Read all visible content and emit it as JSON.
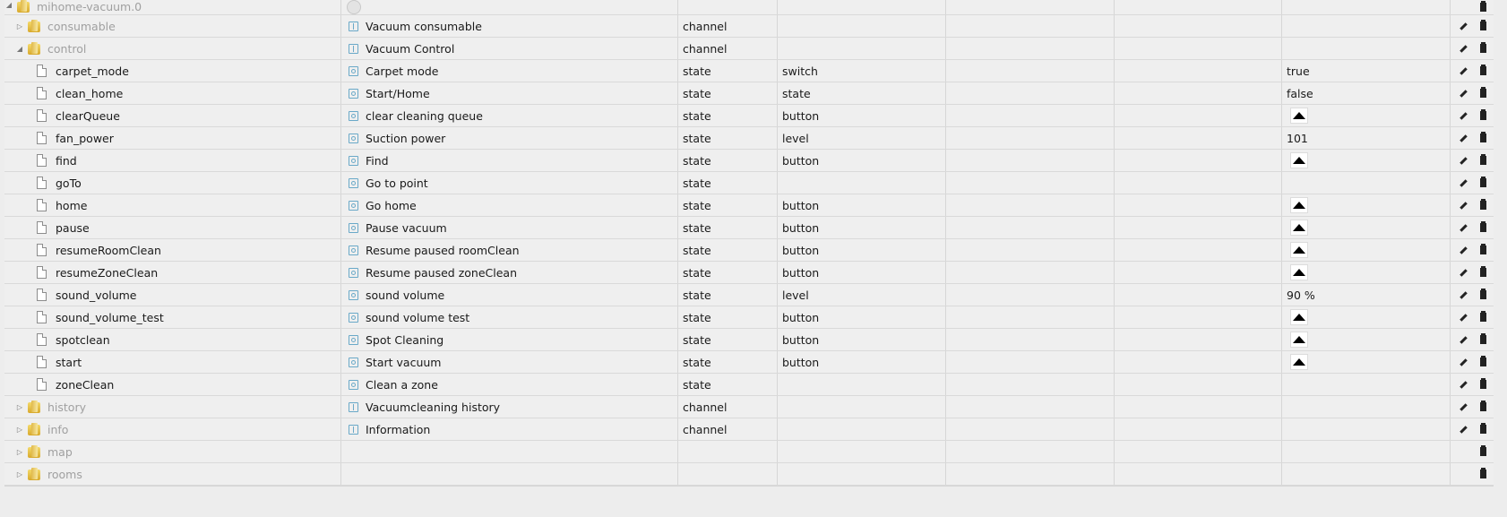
{
  "root": {
    "id": "mihome-vacuum.0"
  },
  "rows": [
    {
      "kind": "folder",
      "id": "consumable",
      "toggle": "▷",
      "name": "Vacuum consumable",
      "type": "channel",
      "role": "",
      "value": "",
      "button": false,
      "edit": true,
      "nameIcon": "channel"
    },
    {
      "kind": "folder",
      "id": "control",
      "toggle": "◢",
      "name": "Vacuum Control",
      "type": "channel",
      "role": "",
      "value": "",
      "button": false,
      "edit": true,
      "nameIcon": "channel"
    },
    {
      "kind": "state",
      "id": "carpet_mode",
      "name": "Carpet mode",
      "type": "state",
      "role": "switch",
      "value": "true",
      "button": false,
      "edit": true,
      "nameIcon": "state"
    },
    {
      "kind": "state",
      "id": "clean_home",
      "name": "Start/Home",
      "type": "state",
      "role": "state",
      "value": "false",
      "button": false,
      "edit": true,
      "nameIcon": "state"
    },
    {
      "kind": "state",
      "id": "clearQueue",
      "name": "clear cleaning queue",
      "type": "state",
      "role": "button",
      "value": "",
      "button": true,
      "edit": true,
      "nameIcon": "state"
    },
    {
      "kind": "state",
      "id": "fan_power",
      "name": "Suction power",
      "type": "state",
      "role": "level",
      "value": "101",
      "button": false,
      "edit": true,
      "nameIcon": "state"
    },
    {
      "kind": "state",
      "id": "find",
      "name": "Find",
      "type": "state",
      "role": "button",
      "value": "",
      "button": true,
      "edit": true,
      "nameIcon": "state"
    },
    {
      "kind": "state",
      "id": "goTo",
      "name": "Go to point",
      "type": "state",
      "role": "",
      "value": "",
      "button": false,
      "edit": true,
      "nameIcon": "state"
    },
    {
      "kind": "state",
      "id": "home",
      "name": "Go home",
      "type": "state",
      "role": "button",
      "value": "",
      "button": true,
      "edit": true,
      "nameIcon": "state"
    },
    {
      "kind": "state",
      "id": "pause",
      "name": "Pause vacuum",
      "type": "state",
      "role": "button",
      "value": "",
      "button": true,
      "edit": true,
      "nameIcon": "state"
    },
    {
      "kind": "state",
      "id": "resumeRoomClean",
      "name": "Resume paused roomClean",
      "type": "state",
      "role": "button",
      "value": "",
      "button": true,
      "edit": true,
      "nameIcon": "state"
    },
    {
      "kind": "state",
      "id": "resumeZoneClean",
      "name": "Resume paused zoneClean",
      "type": "state",
      "role": "button",
      "value": "",
      "button": true,
      "edit": true,
      "nameIcon": "state"
    },
    {
      "kind": "state",
      "id": "sound_volume",
      "name": "sound volume",
      "type": "state",
      "role": "level",
      "value": "90 %",
      "button": false,
      "edit": true,
      "nameIcon": "state"
    },
    {
      "kind": "state",
      "id": "sound_volume_test",
      "name": "sound volume test",
      "type": "state",
      "role": "button",
      "value": "",
      "button": true,
      "edit": true,
      "nameIcon": "state"
    },
    {
      "kind": "state",
      "id": "spotclean",
      "name": "Spot Cleaning",
      "type": "state",
      "role": "button",
      "value": "",
      "button": true,
      "edit": true,
      "nameIcon": "state"
    },
    {
      "kind": "state",
      "id": "start",
      "name": "Start vacuum",
      "type": "state",
      "role": "button",
      "value": "",
      "button": true,
      "edit": true,
      "nameIcon": "state"
    },
    {
      "kind": "state",
      "id": "zoneClean",
      "name": "Clean a zone",
      "type": "state",
      "role": "",
      "value": "",
      "button": false,
      "edit": true,
      "nameIcon": "state"
    },
    {
      "kind": "folder",
      "id": "history",
      "toggle": "▷",
      "name": "Vacuumcleaning history",
      "type": "channel",
      "role": "",
      "value": "",
      "button": false,
      "edit": true,
      "nameIcon": "channel"
    },
    {
      "kind": "folder",
      "id": "info",
      "toggle": "▷",
      "name": "Information",
      "type": "channel",
      "role": "",
      "value": "",
      "button": false,
      "edit": true,
      "nameIcon": "channel"
    },
    {
      "kind": "folder",
      "id": "map",
      "toggle": "▷",
      "name": "",
      "type": "",
      "role": "",
      "value": "",
      "button": false,
      "edit": false,
      "nameIcon": ""
    },
    {
      "kind": "folder",
      "id": "rooms",
      "toggle": "▷",
      "name": "",
      "type": "",
      "role": "",
      "value": "",
      "button": false,
      "edit": false,
      "nameIcon": ""
    }
  ],
  "icons": {
    "folder": "folder-icon",
    "file": "file-icon",
    "state": "state-icon",
    "channel": "channel-icon",
    "edit": "pencil-icon",
    "delete": "trash-icon",
    "button": "push-button-icon"
  }
}
